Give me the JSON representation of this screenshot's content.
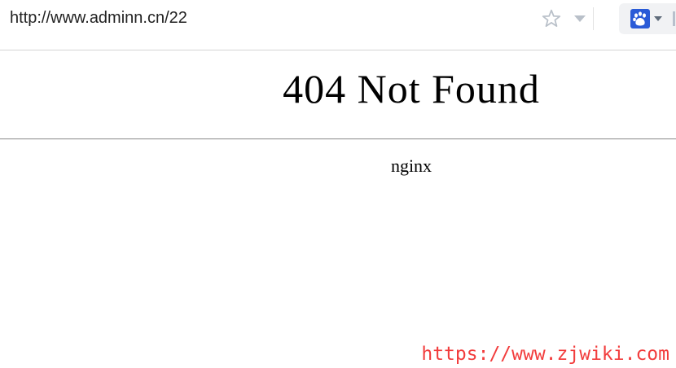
{
  "browser": {
    "url": "http://www.adminn.cn/22",
    "bookmark_icon": "star-icon",
    "dropdown_icon": "chevron-down-icon",
    "extension_icon": "baidu-paw-icon",
    "colors": {
      "extension_icon": "#2a5bd7",
      "toolbar_icon": "#b9c0c9"
    }
  },
  "page": {
    "heading": "404 Not Found",
    "server": "nginx"
  },
  "watermark": {
    "text": "https://www.zjwiki.com",
    "color": "#f23d3d"
  }
}
